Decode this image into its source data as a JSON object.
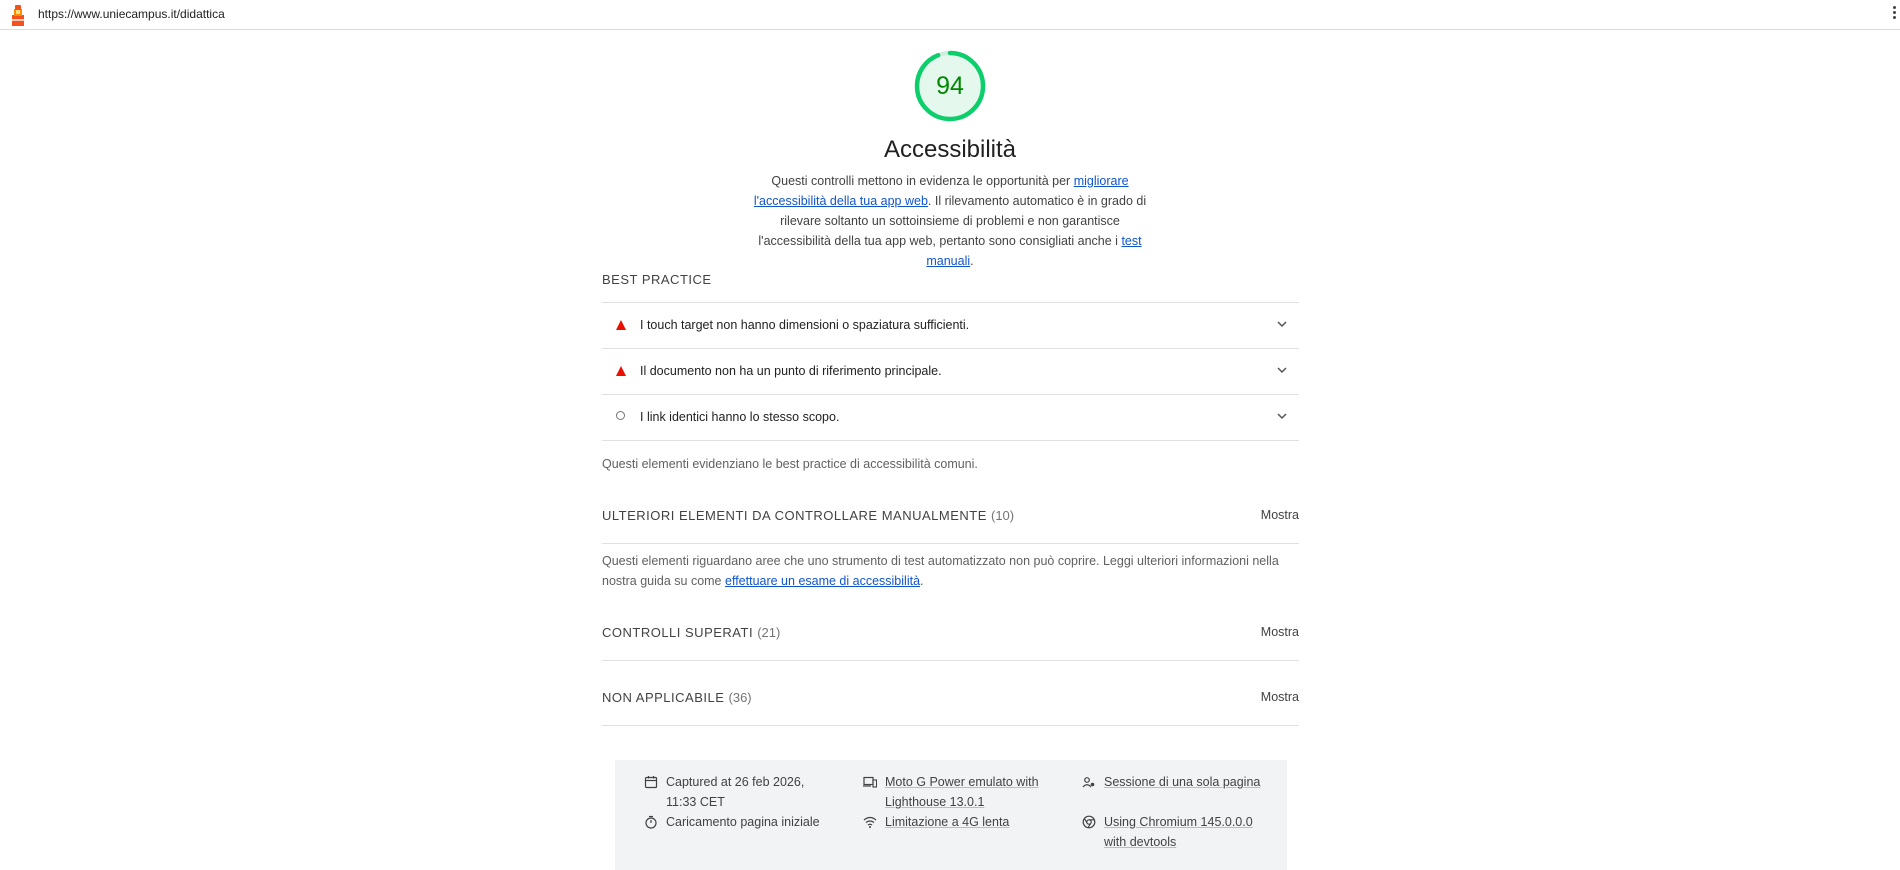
{
  "topbar": {
    "url": "https://www.uniecampus.it/didattica",
    "logo_icon": "lighthouse-icon",
    "menu_icon": "kebab-menu-icon"
  },
  "category": {
    "score": "94",
    "score_fraction": 0.94,
    "score_color": "#0cce6b",
    "title": "Accessibilità",
    "desc_part1": "Questi controlli mettono in evidenza le opportunità per ",
    "desc_link1": "migliorare l'accessibilità della tua app web",
    "desc_part2": ". Il rilevamento automatico è in grado di rilevare soltanto un sottoinsieme di problemi e non garantisce l'accessibilità della tua app web, pertanto sono consigliati anche i ",
    "desc_link2": "test manuali",
    "desc_part3": "."
  },
  "best_practice": {
    "title": "BEST PRACTICE",
    "audits": [
      {
        "text": "I touch target non hanno dimensioni o spaziatura sufficienti.",
        "status": "fail",
        "icon": "warning-triangle-icon"
      },
      {
        "text": "Il documento non ha un punto di riferimento principale.",
        "status": "fail",
        "icon": "warning-triangle-icon"
      },
      {
        "text": "I link identici hanno lo stesso scopo.",
        "status": "informative",
        "icon": "circle-icon"
      }
    ],
    "description": "Questi elementi evidenziano le best practice di accessibilità comuni."
  },
  "manual": {
    "title": "ULTERIORI ELEMENTI DA CONTROLLARE MANUALMENTE",
    "count": "(10)",
    "show_label": "Mostra",
    "desc_part1": "Questi elementi riguardano aree che uno strumento di test automatizzato non può coprire. Leggi ulteriori informazioni nella nostra guida su come ",
    "desc_link": "effettuare un esame di accessibilità",
    "desc_part2": "."
  },
  "passed": {
    "title": "CONTROLLI SUPERATI",
    "count": "(21)",
    "show_label": "Mostra"
  },
  "not_applicable": {
    "title": "NON APPLICABILE",
    "count": "(36)",
    "show_label": "Mostra"
  },
  "footer": {
    "captured": "Captured at 26 feb 2026, 11:33 CET",
    "load": "Caricamento pagina iniziale",
    "device": "Moto G Power emulato with Lighthouse 13.0.1",
    "throttling": "Limitazione a 4G lenta",
    "session": "Sessione di una sola pagina",
    "browser": "Using Chromium 145.0.0.0 with devtools"
  },
  "colors": {
    "fail": "#eb0f00",
    "pass": "#0cce6b",
    "link": "#1155cc"
  }
}
